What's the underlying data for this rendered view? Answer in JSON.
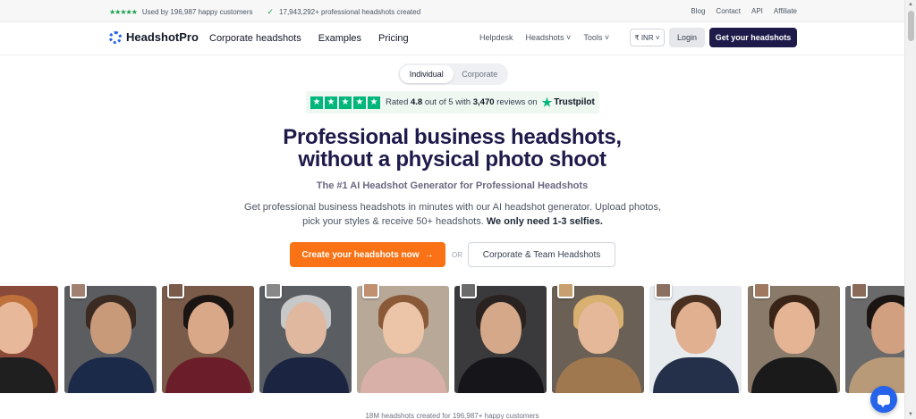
{
  "topbar": {
    "stars": "★★★★★",
    "used_by": "Used by 196,987 happy customers",
    "check": "✓",
    "created": "17,943,292+ professional headshots created",
    "links": [
      "Blog",
      "Contact",
      "API",
      "Affiliate"
    ]
  },
  "nav": {
    "logo_text": "HeadshotPro",
    "links": [
      "Corporate headshots",
      "Examples",
      "Pricing"
    ],
    "secondary": [
      "Helpdesk",
      "Headshots ˅",
      "Tools ˅"
    ],
    "currency": "₹ INR ˅",
    "login": "Login",
    "cta": "Get your headshots"
  },
  "toggle": {
    "options": [
      "Individual",
      "Corporate"
    ],
    "active": "Individual"
  },
  "trustpilot": {
    "star": "★",
    "rated": "Rated",
    "rating": "4.8",
    "out_of": "out of 5 with",
    "reviews": "3,470",
    "reviews_on": "reviews on",
    "brand": "Trustpilot",
    "brand_color": "#00b67a"
  },
  "hero": {
    "title_line1": "Professional business headshots,",
    "title_line2": "without a physical photo shoot",
    "subtitle": "The #1 AI Headshot Generator for Professional Headshots",
    "desc_plain": "Get professional business headshots in minutes with our AI headshot generator. Upload photos, pick your styles & receive 50+ headshots.",
    "desc_bold": "We only need 1-3 selfies.",
    "primary_cta": "Create your headshots now",
    "primary_arrow": "→",
    "or": "OR",
    "secondary_cta": "Corporate & Team Headshots"
  },
  "gallery": {
    "photos": [
      {
        "bg": "#8a4a3a",
        "skin": "#e8b89a",
        "hair": "#c0703a",
        "body": "#1f1f1f",
        "thumb": "#b9876a"
      },
      {
        "bg": "#5b5d60",
        "skin": "#c89a7a",
        "hair": "#3a2a22",
        "body": "#1c2a4a",
        "thumb": "#a08070"
      },
      {
        "bg": "#7a5a48",
        "skin": "#d8a888",
        "hair": "#1a1412",
        "body": "#6b1e2a",
        "thumb": "#7a5a4a"
      },
      {
        "bg": "#5a5e62",
        "skin": "#e0b8a0",
        "hair": "#c8c8c8",
        "body": "#1b2440",
        "thumb": "#888888"
      },
      {
        "bg": "#b8a898",
        "skin": "#ecc4a8",
        "hair": "#8a5a38",
        "body": "#d8b0a8",
        "thumb": "#c09070"
      },
      {
        "bg": "#3a3a3c",
        "skin": "#d4a888",
        "hair": "#2a2220",
        "body": "#15151a",
        "thumb": "#6a6a6a"
      },
      {
        "bg": "#6a6055",
        "skin": "#e4b898",
        "hair": "#d8b070",
        "body": "#a07850",
        "thumb": "#c8a070"
      },
      {
        "bg": "#e8ebee",
        "skin": "#e0b090",
        "hair": "#4a3020",
        "body": "#24304a",
        "thumb": "#8a7060"
      },
      {
        "bg": "#8a7a6a",
        "skin": "#e4b494",
        "hair": "#3a2418",
        "body": "#1a1a1a",
        "thumb": "#a07860"
      },
      {
        "bg": "#6a6a6a",
        "skin": "#d0a080",
        "hair": "#1a1412",
        "body": "#b89a78",
        "thumb": "#8a6a58"
      }
    ]
  },
  "bottom_text": "18M headshots created for 196,987+ happy customers",
  "colors": {
    "accent": "#f97316",
    "navy": "#1e1b4b",
    "chat": "#2563eb"
  }
}
